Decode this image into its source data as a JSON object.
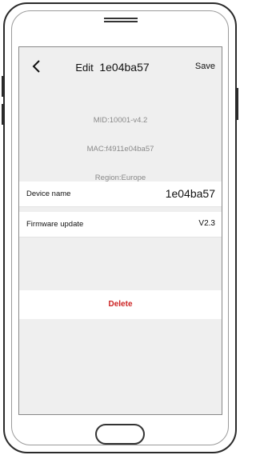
{
  "nav": {
    "title_prefix": "Edit",
    "title_device": "1e04ba57",
    "save_label": "Save"
  },
  "info": {
    "mid": "MID:10001-v4.2",
    "mac": "MAC:f4911e04ba57",
    "region": "Region:Europe"
  },
  "settings": {
    "device_name_label": "Device name",
    "device_name_value": "1e04ba57",
    "firmware_label": "Firmware update",
    "firmware_value": "V2.3"
  },
  "actions": {
    "delete_label": "Delete"
  },
  "colors": {
    "background": "#efefef",
    "row_background": "#ffffff",
    "delete_text": "#cc2222",
    "info_text": "#8a8a8a"
  }
}
